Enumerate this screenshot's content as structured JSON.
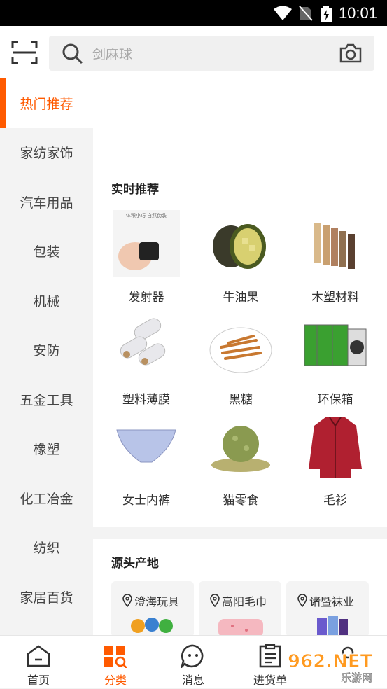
{
  "status": {
    "time": "10:01"
  },
  "search": {
    "placeholder": "剑麻球"
  },
  "sidebar": {
    "items": [
      {
        "label": "热门推荐"
      },
      {
        "label": "家纺家饰"
      },
      {
        "label": "汽车用品"
      },
      {
        "label": "包装"
      },
      {
        "label": "机械"
      },
      {
        "label": "安防"
      },
      {
        "label": "五金工具"
      },
      {
        "label": "橡塑"
      },
      {
        "label": "化工冶金"
      },
      {
        "label": "纺织"
      },
      {
        "label": "家居百货"
      }
    ]
  },
  "realtime": {
    "title": "实时推荐",
    "products": [
      {
        "name": "发射器",
        "icon": "transmitter-image"
      },
      {
        "name": "牛油果",
        "icon": "avocado-image"
      },
      {
        "name": "木塑材料",
        "icon": "wood-plastic-image"
      },
      {
        "name": "塑料薄膜",
        "icon": "plastic-film-image"
      },
      {
        "name": "黑糖",
        "icon": "brown-sugar-image"
      },
      {
        "name": "环保箱",
        "icon": "eco-box-image"
      },
      {
        "name": "女士内裤",
        "icon": "underwear-image"
      },
      {
        "name": "猫零食",
        "icon": "cat-treat-image"
      },
      {
        "name": "毛衫",
        "icon": "shirt-image"
      }
    ],
    "product_image_caption": "体积小巧 自然伪装"
  },
  "origin": {
    "title": "源头产地",
    "places": [
      {
        "name": "澄海玩具"
      },
      {
        "name": "高阳毛巾"
      },
      {
        "name": "诸暨袜业"
      }
    ]
  },
  "tabs": [
    {
      "label": "首页"
    },
    {
      "label": "分类"
    },
    {
      "label": "消息"
    },
    {
      "label": "进货单"
    },
    {
      "label": ""
    }
  ],
  "watermark": {
    "text": "962.NET",
    "sub": "乐游网"
  },
  "colors": {
    "accent": "#ff5a00"
  }
}
